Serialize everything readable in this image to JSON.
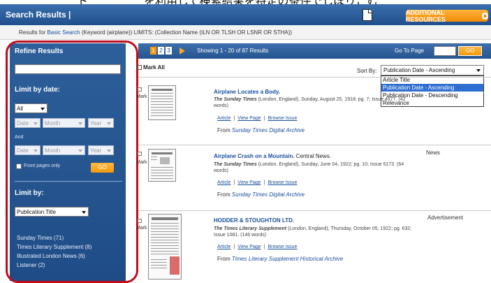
{
  "caption": "ト　　　　　を利用して検索結果を特定の条件でしぼりこむ",
  "header": {
    "title": "Search Results |",
    "additional_resources": "ADDITIONAL RESOURCES"
  },
  "results_for": {
    "prefix": "Results for",
    "search_type": "Basic Search",
    "query": " (Keyword (airplane)) LIMITS: (Collection Name (ILN OR TLSH OR LSNR OR STHA))"
  },
  "sidebar": {
    "refine_title": "Refine Results",
    "refine_input_value": "",
    "limit_by_date_title": "Limit by date:",
    "date_mode": "All",
    "from_date": {
      "day": "Date",
      "month": "Month",
      "year": "Year"
    },
    "and_label": "And",
    "to_date": {
      "day": "Date",
      "month": "Month",
      "year": "Year"
    },
    "front_pages_label": "Front pages only",
    "go_label": "GO",
    "limit_by_title": "Limit by:",
    "limit_by_select": "Publication Title",
    "facets": [
      "Sunday Times (71)",
      "Times Literary Supplement (8)",
      "Illustrated London News (6)",
      "Listener (2)"
    ]
  },
  "pagination": {
    "pages": [
      "1",
      "2",
      "3"
    ],
    "showing": "Showing 1 - 20 of 87 Results",
    "goto_label": "Go To Page",
    "goto_value": "",
    "goto_button": "GO"
  },
  "results_toolbar": {
    "mark_all": "Mark All",
    "sort_label": "Sort By:",
    "sort_selected": "Publication Date - Ascending",
    "sort_options": [
      "Article Title",
      "Publication Date - Ascending",
      "Publication Date - Descending",
      "Relevance"
    ]
  },
  "results": [
    {
      "mark": "Mark",
      "title": "Airplane Locates a Body.",
      "subtitle": "",
      "publication": "The Sunday Times",
      "citation": " (London, England), Sunday, August 25, 1918; pg. 7; Issue 4977.  (42 words)",
      "type": "",
      "links": {
        "article": "Article",
        "view_page": "View Page",
        "browse_issue": "Browse Issue"
      },
      "from_label": "From",
      "source": "Sunday Times Digital Archive"
    },
    {
      "mark": "Mark",
      "title": "Airplane Crash on a Mountain.",
      "subtitle": " Central News.",
      "publication": "The Sunday Times",
      "citation": " (London, England), Sunday, June 04, 1922; pg. 10; Issue 5173.  (64 words)",
      "type": "News",
      "links": {
        "article": "Article",
        "view_page": "View Page",
        "browse_issue": "Browse Issue"
      },
      "from_label": "From",
      "source": "Sunday Times Digital Archive"
    },
    {
      "mark": "Mark",
      "title": "HODDER & STOUGHTON LTD.",
      "subtitle": "",
      "publication": "The Times Literary Supplement",
      "citation": " (London, England), Thursday, October 05, 1922; pg. 632; Issue 1081.  (146 words)",
      "type": "Advertisement",
      "links": {
        "article": "Article",
        "view_page": "View Page",
        "browse_issue": "Browse Issue"
      },
      "from_label": "From",
      "source": "Times Literary Supplement Historical Archive"
    }
  ],
  "colors": {
    "header_blue": "#1f4f8c",
    "sidebar_blue": "#2d5f9a",
    "accent_orange": "#f39a0e",
    "highlight_red": "#c00d1e",
    "link_blue": "#1b4fa0"
  }
}
